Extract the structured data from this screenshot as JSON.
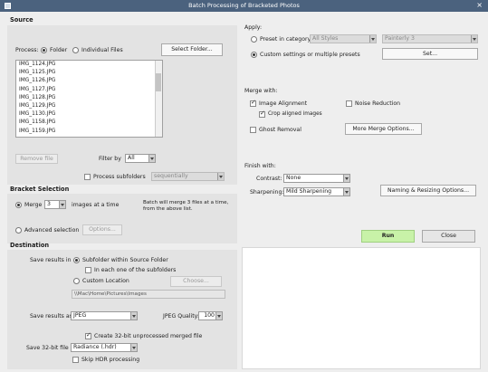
{
  "window": {
    "title": "Batch Processing of Bracketed Photos",
    "close_glyph": "×"
  },
  "source": {
    "heading": "Source",
    "process_label": "Process:",
    "option_folder": "Folder",
    "option_individual": "Individual Files",
    "select_folder_button": "Select Folder...",
    "files": [
      "IMG_1124.JPG",
      "IMG_1125.JPG",
      "IMG_1126.JPG",
      "IMG_1127.JPG",
      "IMG_1128.JPG",
      "IMG_1129.JPG",
      "IMG_1130.JPG",
      "IMG_1158.JPG",
      "IMG_1159.JPG"
    ],
    "remove_button": "Remove file",
    "filter_label": "Filter by",
    "filter_value": "All",
    "subfolders_label": "Process subfolders",
    "subfolders_mode": "sequentially"
  },
  "bracket": {
    "heading": "Bracket Selection",
    "merge_label": "Merge",
    "merge_count": "3",
    "images_label": "images at a time",
    "info_text_1": "Batch will merge 3 files at a time,",
    "info_text_2": "from the above list.",
    "advanced_label": "Advanced selection",
    "options_button": "Options..."
  },
  "destination": {
    "heading": "Destination",
    "save_in_label": "Save results in",
    "subfolder_option": "Subfolder within Source Folder",
    "each_subfolder_label": "In each one of the subfolders",
    "custom_location_option": "Custom Location",
    "choose_button": "Choose...",
    "path": "\\\\Mac\\Home\\Pictures\\Images",
    "save_as_label": "Save results as",
    "format_value": "JPEG",
    "quality_label": "JPEG Quality:",
    "quality_value": "100",
    "create32_label": "Create 32-bit unprocessed merged file",
    "save32_label": "Save 32-bit file as",
    "save32_value": "Radiance (.hdr)",
    "skip_hdr_label": "Skip HDR processing"
  },
  "apply": {
    "heading": "Apply:",
    "preset_category_label": "Preset in category",
    "category_value": "All Styles",
    "preset_value": "Painterly 3",
    "custom_label": "Custom settings or multiple presets",
    "set_button": "Set..."
  },
  "merge_with": {
    "heading": "Merge with:",
    "image_alignment": "Image Alignment",
    "noise_reduction": "Noise Reduction",
    "crop_aligned": "Crop aligned images",
    "ghost_removal": "Ghost Removal",
    "more_options_button": "More Merge Options..."
  },
  "finish_with": {
    "heading": "Finish with:",
    "contrast_label": "Contrast:",
    "contrast_value": "None",
    "sharpening_label": "Sharpening:",
    "sharpening_value": "Mild Sharpening",
    "naming_button": "Naming & Resizing Options..."
  },
  "actions": {
    "run": "Run",
    "close": "Close"
  },
  "colors": {
    "titlebar": "#4b627e",
    "run_button": "#c8f2a8",
    "panel": "#e3e3e3"
  }
}
